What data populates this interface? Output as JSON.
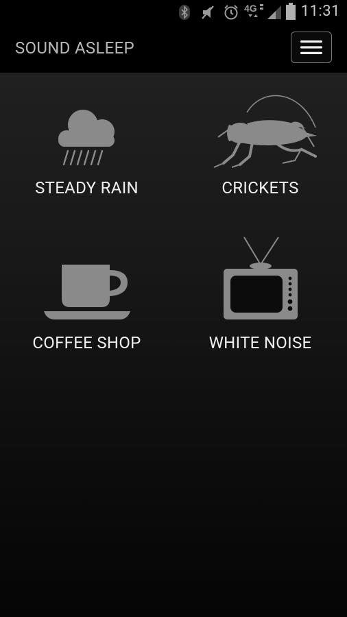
{
  "status_bar": {
    "time": "11:31",
    "network": "4G",
    "icons": [
      "bluetooth-icon",
      "mute-icon",
      "alarm-icon",
      "4g-icon",
      "signal-icon",
      "battery-icon"
    ]
  },
  "app": {
    "title": "SOUND ASLEEP",
    "menu_icon": "hamburger-icon"
  },
  "sounds": [
    {
      "label": "STEADY RAIN",
      "icon": "rain-cloud-icon"
    },
    {
      "label": "CRICKETS",
      "icon": "cricket-icon"
    },
    {
      "label": "COFFEE SHOP",
      "icon": "coffee-cup-icon"
    },
    {
      "label": "WHITE NOISE",
      "icon": "television-icon"
    }
  ],
  "colors": {
    "background": "#000000",
    "icon_gray": "#8a8a8a",
    "text": "#efefef",
    "title": "#b8b8b8"
  }
}
